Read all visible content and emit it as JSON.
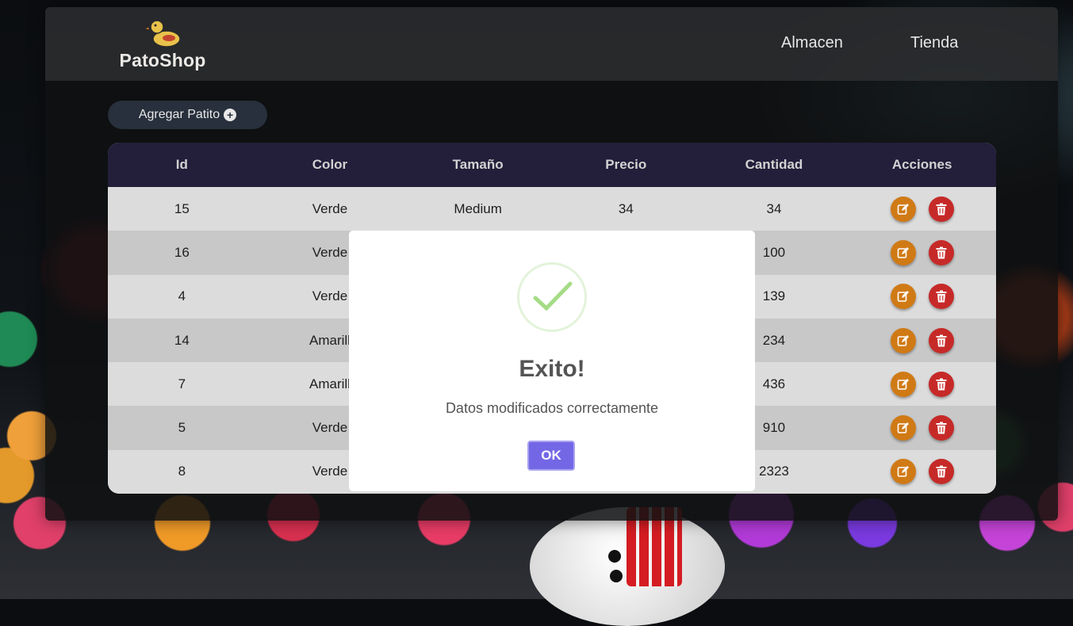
{
  "brand": {
    "name": "PatoShop",
    "logo_icon": "duck-icon"
  },
  "nav": {
    "links": [
      "Almacen",
      "Tienda"
    ]
  },
  "toolbar": {
    "add_label": "Agregar Patito",
    "add_icon": "plus-circle-icon"
  },
  "table": {
    "headers": [
      "Id",
      "Color",
      "Tamaño",
      "Precio",
      "Cantidad",
      "Acciones"
    ],
    "rows": [
      [
        "15",
        "Verde",
        "Medium",
        "34",
        "34"
      ],
      [
        "16",
        "Verde",
        "",
        "",
        "100"
      ],
      [
        "4",
        "Verde",
        "",
        "",
        "139"
      ],
      [
        "14",
        "Amarill",
        "",
        "",
        "234"
      ],
      [
        "7",
        "Amarill",
        "",
        "",
        "436"
      ],
      [
        "5",
        "Verde",
        "",
        "",
        "910"
      ],
      [
        "8",
        "Verde",
        "",
        "",
        "2323"
      ]
    ],
    "row_actions": [
      "edit-icon",
      "trash-icon"
    ]
  },
  "modal": {
    "icon": "check-icon",
    "title": "Exito!",
    "message": "Datos modificados correctamente",
    "ok_label": "OK"
  },
  "colors": {
    "header_bg": "#231e3a",
    "edit": "#d07a16",
    "delete": "#c62a28",
    "ok_button": "#7367e6",
    "success": "#a5dc86"
  }
}
